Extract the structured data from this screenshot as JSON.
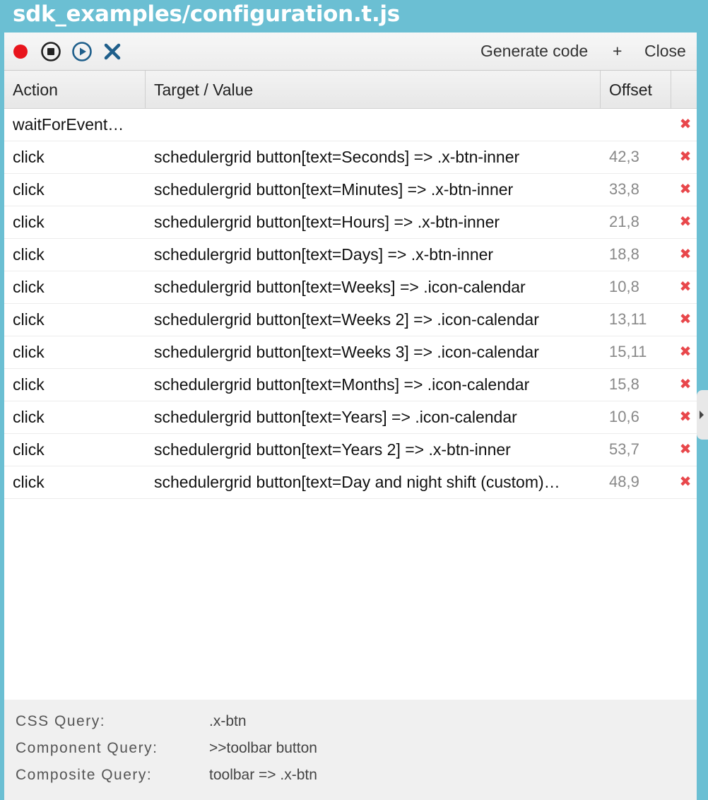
{
  "window": {
    "title": "sdk_examples/configuration.t.js"
  },
  "toolbar": {
    "record_icon": "record-icon",
    "stop_icon": "stop-icon",
    "play_icon": "play-icon",
    "clear_icon": "close-x-icon",
    "generate_code_label": "Generate code",
    "add_label": "+",
    "close_label": "Close",
    "colors": {
      "record": "#e8141c",
      "accent": "#1f5f8b"
    }
  },
  "grid": {
    "columns": [
      "Action",
      "Target / Value",
      "Offset"
    ],
    "rows": [
      {
        "action": "waitForEvent…",
        "target": "",
        "offset": "",
        "delete": "✖"
      },
      {
        "action": "click",
        "target": "schedulergrid button[text=Seconds] => .x-btn-inner",
        "offset": "42,3",
        "delete": "✖"
      },
      {
        "action": "click",
        "target": "schedulergrid button[text=Minutes] => .x-btn-inner",
        "offset": "33,8",
        "delete": "✖"
      },
      {
        "action": "click",
        "target": "schedulergrid button[text=Hours] => .x-btn-inner",
        "offset": "21,8",
        "delete": "✖"
      },
      {
        "action": "click",
        "target": "schedulergrid button[text=Days] => .x-btn-inner",
        "offset": "18,8",
        "delete": "✖"
      },
      {
        "action": "click",
        "target": "schedulergrid button[text=Weeks] => .icon-calendar",
        "offset": "10,8",
        "delete": "✖"
      },
      {
        "action": "click",
        "target": "schedulergrid button[text=Weeks 2] => .icon-calendar",
        "offset": "13,11",
        "delete": "✖"
      },
      {
        "action": "click",
        "target": "schedulergrid button[text=Weeks 3] => .icon-calendar",
        "offset": "15,11",
        "delete": "✖"
      },
      {
        "action": "click",
        "target": "schedulergrid button[text=Months] => .icon-calendar",
        "offset": "15,8",
        "delete": "✖"
      },
      {
        "action": "click",
        "target": "schedulergrid button[text=Years] => .icon-calendar",
        "offset": "10,6",
        "delete": "✖"
      },
      {
        "action": "click",
        "target": "schedulergrid button[text=Years 2] => .x-btn-inner",
        "offset": "53,7",
        "delete": "✖"
      },
      {
        "action": "click",
        "target": "schedulergrid button[text=Day and night shift (custom)…",
        "offset": "48,9",
        "delete": "✖"
      }
    ]
  },
  "queries": [
    {
      "label": "CSS Query:",
      "value": ".x-btn"
    },
    {
      "label": "Component Query:",
      "value": ">>toolbar button"
    },
    {
      "label": "Composite Query:",
      "value": "toolbar => .x-btn"
    }
  ]
}
